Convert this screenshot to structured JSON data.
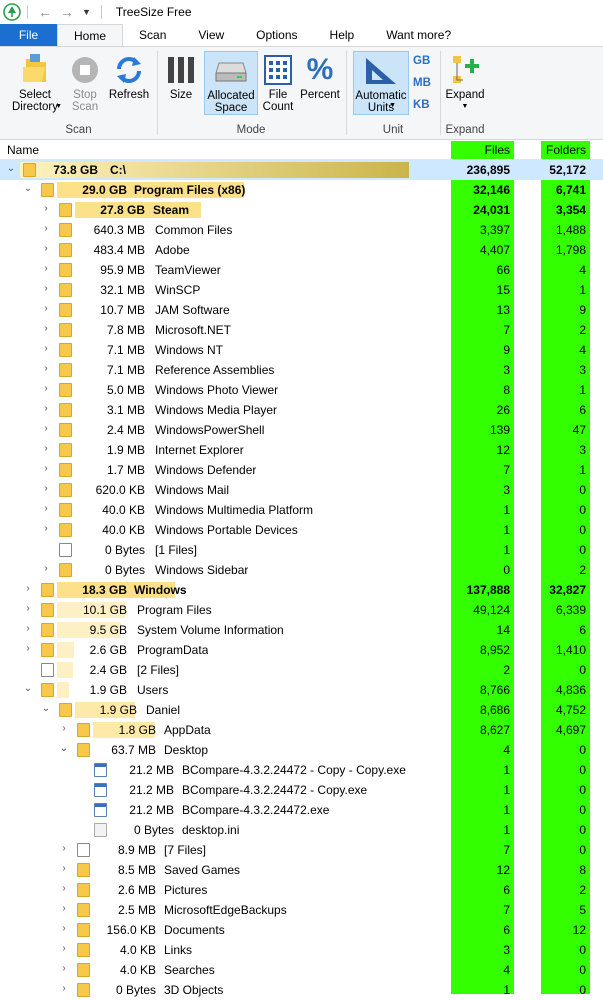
{
  "app": {
    "title": "TreeSize Free"
  },
  "tabs": [
    "File",
    "Home",
    "Scan",
    "View",
    "Options",
    "Help",
    "Want more?"
  ],
  "ribbon": {
    "scan": {
      "label": "Scan",
      "select_directory": "Select\nDirectory",
      "stop_scan": "Stop\nScan",
      "refresh": "Refresh"
    },
    "mode": {
      "label": "Mode",
      "size": "Size",
      "allocated_space": "Allocated\nSpace",
      "file_count": "File\nCount",
      "percent": "Percent"
    },
    "unit": {
      "label": "Unit",
      "automatic_units": "Automatic\nUnits",
      "gb": "GB",
      "mb": "MB",
      "kb": "KB"
    },
    "expand": {
      "label": "Expand",
      "expand": "Expand"
    }
  },
  "columns": {
    "name": "Name",
    "files": "Files",
    "folders": "Folders"
  },
  "rows": [
    {
      "size": "73.8 GB",
      "name": "C:\\",
      "files": "236,895",
      "folders": "52,172"
    },
    {
      "size": "29.0 GB",
      "name": "Program Files (x86)",
      "files": "32,146",
      "folders": "6,741"
    },
    {
      "size": "27.8 GB",
      "name": "Steam",
      "files": "24,031",
      "folders": "3,354"
    },
    {
      "size": "640.3 MB",
      "name": "Common Files",
      "files": "3,397",
      "folders": "1,488"
    },
    {
      "size": "483.4 MB",
      "name": "Adobe",
      "files": "4,407",
      "folders": "1,798"
    },
    {
      "size": "95.9 MB",
      "name": "TeamViewer",
      "files": "66",
      "folders": "4"
    },
    {
      "size": "32.1 MB",
      "name": "WinSCP",
      "files": "15",
      "folders": "1"
    },
    {
      "size": "10.7 MB",
      "name": "JAM Software",
      "files": "13",
      "folders": "9"
    },
    {
      "size": "7.8 MB",
      "name": "Microsoft.NET",
      "files": "7",
      "folders": "2"
    },
    {
      "size": "7.1 MB",
      "name": "Windows NT",
      "files": "9",
      "folders": "4"
    },
    {
      "size": "7.1 MB",
      "name": "Reference Assemblies",
      "files": "3",
      "folders": "3"
    },
    {
      "size": "5.0 MB",
      "name": "Windows Photo Viewer",
      "files": "8",
      "folders": "1"
    },
    {
      "size": "3.1 MB",
      "name": "Windows Media Player",
      "files": "26",
      "folders": "6"
    },
    {
      "size": "2.4 MB",
      "name": "WindowsPowerShell",
      "files": "139",
      "folders": "47"
    },
    {
      "size": "1.9 MB",
      "name": "Internet Explorer",
      "files": "12",
      "folders": "3"
    },
    {
      "size": "1.7 MB",
      "name": "Windows Defender",
      "files": "7",
      "folders": "1"
    },
    {
      "size": "620.0 KB",
      "name": "Windows Mail",
      "files": "3",
      "folders": "0"
    },
    {
      "size": "40.0 KB",
      "name": "Windows Multimedia Platform",
      "files": "1",
      "folders": "0"
    },
    {
      "size": "40.0 KB",
      "name": "Windows Portable Devices",
      "files": "1",
      "folders": "0"
    },
    {
      "size": "0 Bytes",
      "name": "[1 Files]",
      "files": "1",
      "folders": "0"
    },
    {
      "size": "0 Bytes",
      "name": "Windows Sidebar",
      "files": "0",
      "folders": "2"
    },
    {
      "size": "18.3 GB",
      "name": "Windows",
      "files": "137,888",
      "folders": "32,827"
    },
    {
      "size": "10.1 GB",
      "name": "Program Files",
      "files": "49,124",
      "folders": "6,339"
    },
    {
      "size": "9.5 GB",
      "name": "System Volume Information",
      "files": "14",
      "folders": "6"
    },
    {
      "size": "2.6 GB",
      "name": "ProgramData",
      "files": "8,952",
      "folders": "1,410"
    },
    {
      "size": "2.4 GB",
      "name": "[2 Files]",
      "files": "2",
      "folders": "0"
    },
    {
      "size": "1.9 GB",
      "name": "Users",
      "files": "8,766",
      "folders": "4,836"
    },
    {
      "size": "1.9 GB",
      "name": "Daniel",
      "files": "8,686",
      "folders": "4,752"
    },
    {
      "size": "1.8 GB",
      "name": "AppData",
      "files": "8,627",
      "folders": "4,697"
    },
    {
      "size": "63.7 MB",
      "name": "Desktop",
      "files": "4",
      "folders": "0"
    },
    {
      "size": "21.2 MB",
      "name": "BCompare-4.3.2.24472 - Copy - Copy.exe",
      "files": "1",
      "folders": "0"
    },
    {
      "size": "21.2 MB",
      "name": "BCompare-4.3.2.24472 - Copy.exe",
      "files": "1",
      "folders": "0"
    },
    {
      "size": "21.2 MB",
      "name": "BCompare-4.3.2.24472.exe",
      "files": "1",
      "folders": "0"
    },
    {
      "size": "0 Bytes",
      "name": "desktop.ini",
      "files": "1",
      "folders": "0"
    },
    {
      "size": "8.9 MB",
      "name": "[7 Files]",
      "files": "7",
      "folders": "0"
    },
    {
      "size": "8.5 MB",
      "name": "Saved Games",
      "files": "12",
      "folders": "8"
    },
    {
      "size": "2.6 MB",
      "name": "Pictures",
      "files": "6",
      "folders": "2"
    },
    {
      "size": "2.5 MB",
      "name": "MicrosoftEdgeBackups",
      "files": "7",
      "folders": "5"
    },
    {
      "size": "156.0 KB",
      "name": "Documents",
      "files": "6",
      "folders": "12"
    },
    {
      "size": "4.0 KB",
      "name": "Links",
      "files": "3",
      "folders": "0"
    },
    {
      "size": "4.0 KB",
      "name": "Searches",
      "files": "4",
      "folders": "0"
    },
    {
      "size": "0 Bytes",
      "name": "3D Objects",
      "files": "1",
      "folders": "0"
    }
  ]
}
